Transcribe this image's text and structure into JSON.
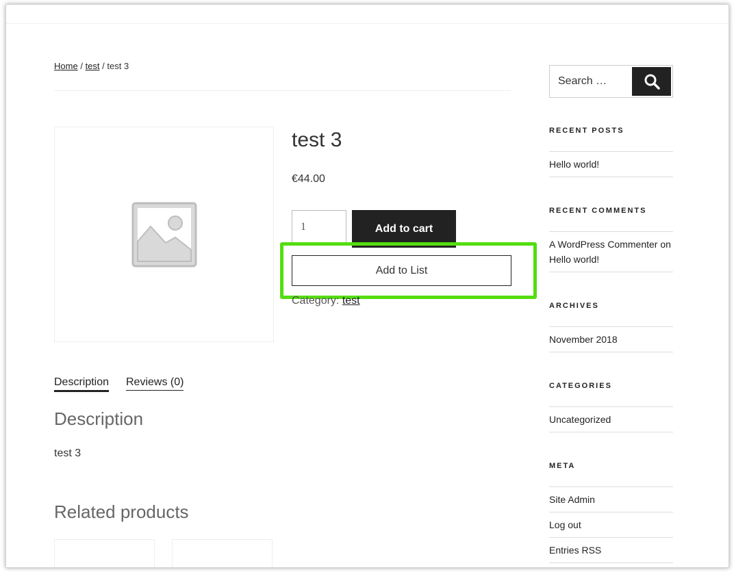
{
  "breadcrumb": {
    "home": "Home",
    "sep1": "/",
    "category": "test",
    "sep2": "/",
    "current": "test 3"
  },
  "product": {
    "title": "test 3",
    "price": "€44.00",
    "quantity": "1",
    "add_to_cart_label": "Add to cart",
    "add_to_list_label": "Add to List",
    "category_label": "Category:",
    "category_value": "test",
    "image_icon": "image-placeholder-icon"
  },
  "tabs": {
    "description": "Description",
    "reviews": "Reviews (0)"
  },
  "description": {
    "heading": "Description",
    "text": "test 3"
  },
  "related": {
    "heading": "Related products"
  },
  "sidebar": {
    "search": {
      "placeholder": "Search …",
      "button_icon": "search-icon"
    },
    "widgets": [
      {
        "title": "RECENT POSTS",
        "items": [
          "Hello world!"
        ]
      },
      {
        "title": "RECENT COMMENTS",
        "items": [
          "A WordPress Commenter on Hello world!"
        ]
      },
      {
        "title": "ARCHIVES",
        "items": [
          "November 2018"
        ]
      },
      {
        "title": "CATEGORIES",
        "items": [
          "Uncategorized"
        ]
      },
      {
        "title": "META",
        "items": [
          "Site Admin",
          "Log out",
          "Entries RSS"
        ]
      }
    ]
  },
  "colors": {
    "button_dark": "#222222",
    "highlight": "#55dd11"
  }
}
